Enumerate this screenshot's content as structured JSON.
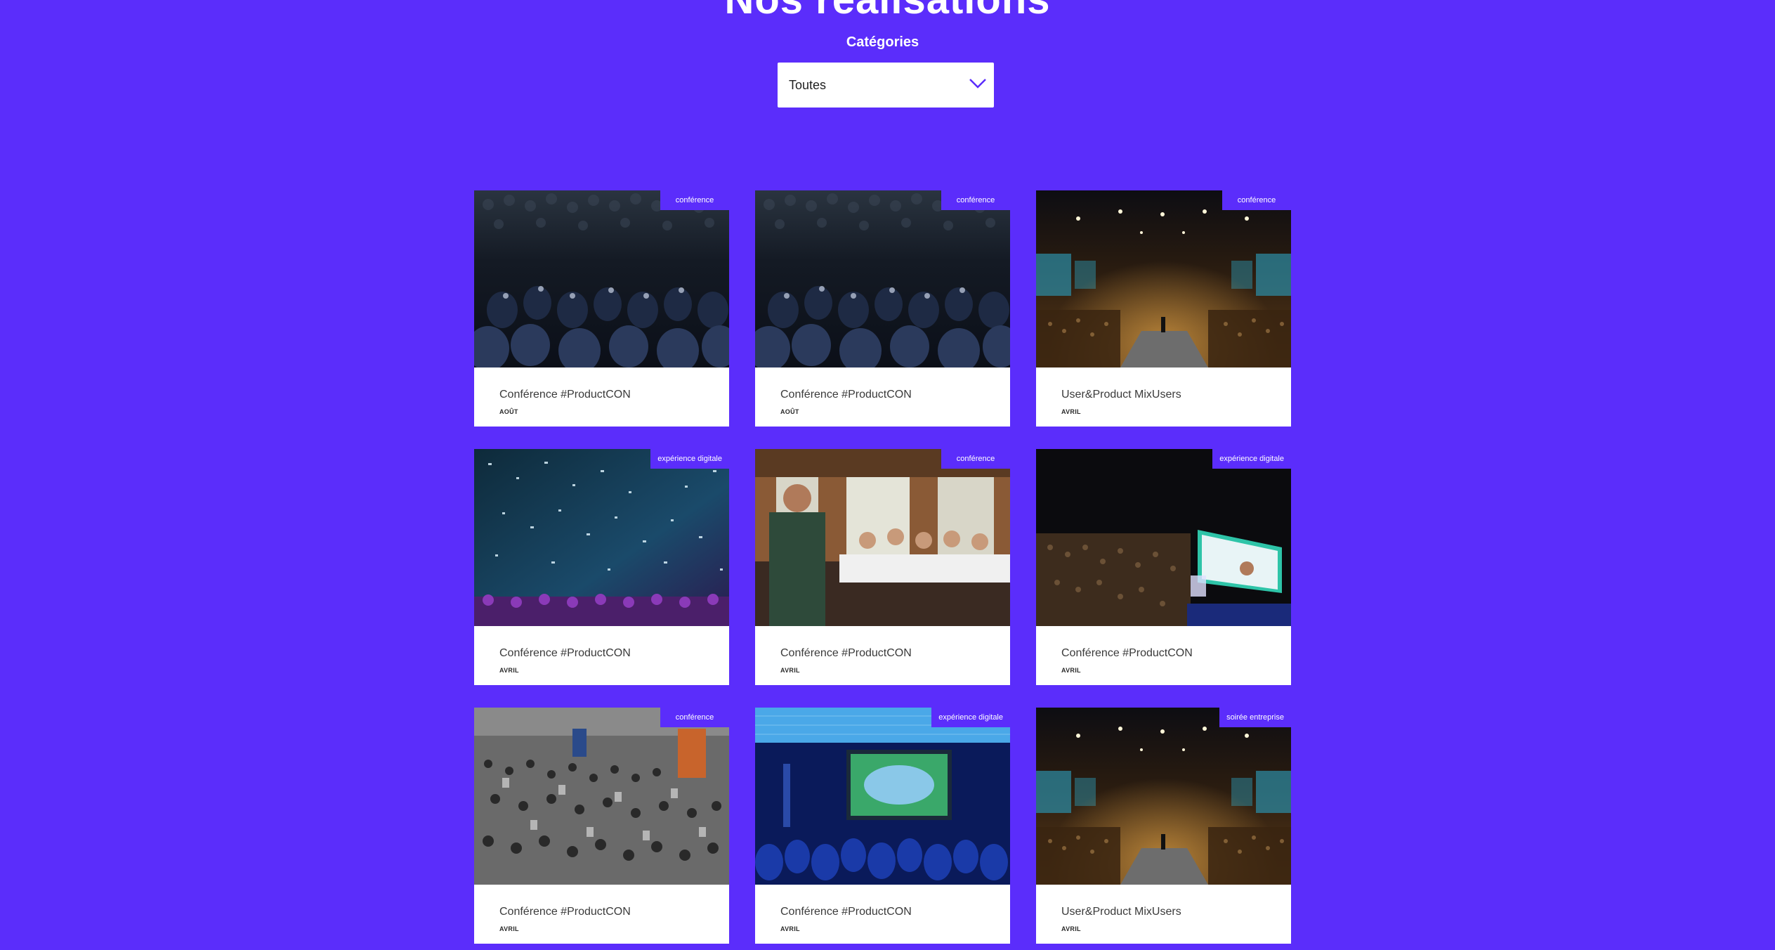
{
  "page": {
    "title": "Nos réalisations",
    "background_color": "#5b2dfb",
    "accent_color": "#5b2dfb"
  },
  "filter": {
    "label": "Catégories",
    "selected": "Toutes",
    "icon": "chevron-down-icon"
  },
  "cards": [
    {
      "title": "Conférence #ProductCON",
      "month": "AOÛT",
      "category": "conférence",
      "image": "dark-audience-photo"
    },
    {
      "title": "Conférence #ProductCON",
      "month": "AOÛT",
      "category": "conférence",
      "image": "dark-audience-photo"
    },
    {
      "title": "User&Product MixUsers",
      "month": "AVRIL",
      "category": "conférence",
      "image": "stage-auditorium-photo"
    },
    {
      "title": "Conférence #ProductCON",
      "month": "AVRIL",
      "category": "expérience digitale",
      "image": "confetti-concert-photo"
    },
    {
      "title": "Conférence #ProductCON",
      "month": "AVRIL",
      "category": "conférence",
      "image": "dinner-speaker-photo"
    },
    {
      "title": "Conférence #ProductCON",
      "month": "AVRIL",
      "category": "expérience digitale",
      "image": "dark-stage-screen-photo"
    },
    {
      "title": "Conférence #ProductCON",
      "month": "AVRIL",
      "category": "conférence",
      "image": "crowd-hall-photo"
    },
    {
      "title": "Conférence #ProductCON",
      "month": "AVRIL",
      "category": "expérience digitale",
      "image": "blue-screening-room-photo"
    },
    {
      "title": "User&Product MixUsers",
      "month": "AVRIL",
      "category": "soirée entreprise",
      "image": "stage-auditorium-photo"
    }
  ]
}
